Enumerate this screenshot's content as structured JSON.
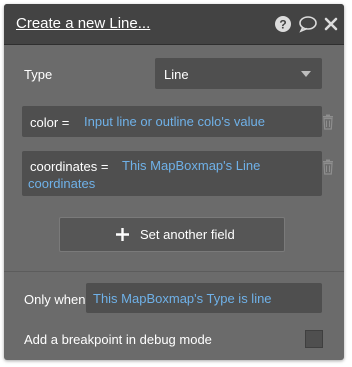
{
  "header": {
    "title": "Create a new Line...",
    "icons": [
      "help-icon",
      "comment-icon",
      "close-icon"
    ]
  },
  "type_field": {
    "label": "Type",
    "value": "Line"
  },
  "fields": [
    {
      "key": "color =",
      "value": "Input line or outline colo's value"
    },
    {
      "key": "coordinates =",
      "value_line1": "This MapBoxmap's Line",
      "value_line2": "coordinates"
    }
  ],
  "add_button": {
    "label": "Set another field"
  },
  "condition": {
    "label": "Only when",
    "value": "This MapBoxmap's Type is line"
  },
  "breakpoint": {
    "label": "Add a breakpoint in debug mode",
    "checked": false
  },
  "colors": {
    "panel": "#6b6b6b",
    "header": "#434343",
    "input": "#4f4f4f",
    "link": "#6fb1e8"
  }
}
